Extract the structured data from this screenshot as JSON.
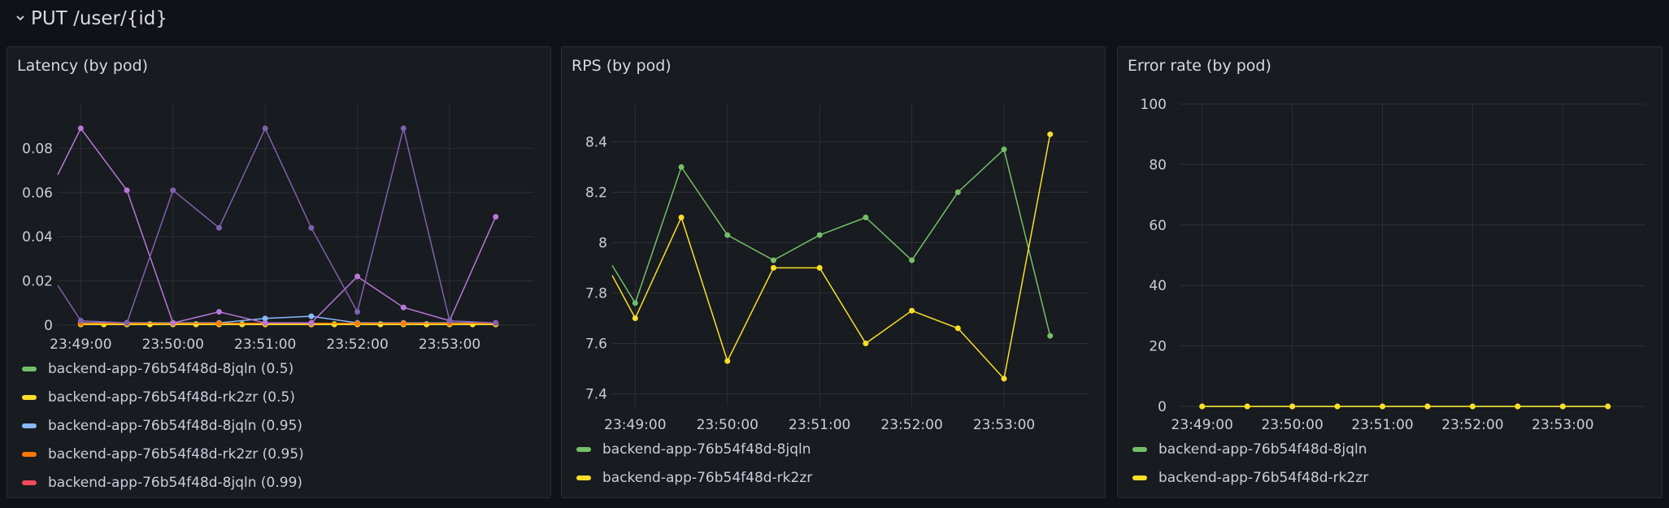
{
  "row": {
    "title": "PUT /user/{id}",
    "chevron": "chevron-down-icon"
  },
  "panels": [
    {
      "title": "Latency (by pod)",
      "legend": [
        {
          "label": "backend-app-76b54f48d-8jqln (0.5)",
          "color": "#73bf69"
        },
        {
          "label": "backend-app-76b54f48d-rk2zr (0.5)",
          "color": "#fade2a"
        },
        {
          "label": "backend-app-76b54f48d-8jqln (0.95)",
          "color": "#8ab8ff"
        },
        {
          "label": "backend-app-76b54f48d-rk2zr (0.95)",
          "color": "#ff780a"
        },
        {
          "label": "backend-app-76b54f48d-8jqln (0.99)",
          "color": "#f2495c"
        }
      ]
    },
    {
      "title": "RPS (by pod)",
      "legend": [
        {
          "label": "backend-app-76b54f48d-8jqln",
          "color": "#73bf69"
        },
        {
          "label": "backend-app-76b54f48d-rk2zr",
          "color": "#fade2a"
        }
      ]
    },
    {
      "title": "Error rate (by pod)",
      "legend": [
        {
          "label": "backend-app-76b54f48d-8jqln",
          "color": "#73bf69"
        },
        {
          "label": "backend-app-76b54f48d-rk2zr",
          "color": "#fade2a"
        }
      ]
    }
  ],
  "chart_data": [
    {
      "type": "line",
      "title": "Latency (by pod)",
      "x": [
        "23:48:45",
        "23:49:00",
        "23:49:15",
        "23:49:30",
        "23:49:45",
        "23:50:00",
        "23:50:15",
        "23:50:30",
        "23:50:45",
        "23:51:00",
        "23:51:15",
        "23:51:30",
        "23:51:45",
        "23:52:00",
        "23:52:15",
        "23:52:30",
        "23:52:45",
        "23:53:00",
        "23:53:15",
        "23:53:30"
      ],
      "x_tick_labels": [
        "23:49:00",
        "23:50:00",
        "23:51:00",
        "23:52:00",
        "23:53:00"
      ],
      "ylim": [
        0,
        0.1
      ],
      "y_ticks": [
        0,
        0.02,
        0.04,
        0.06,
        0.08
      ],
      "y_tick_labels": [
        "0",
        "0.02",
        "0.04",
        "0.06",
        "0.08"
      ],
      "series": [
        {
          "name": "backend-app-76b54f48d-8jqln (0.5)",
          "color": "#73bf69",
          "values": [
            null,
            0.0005,
            0.0005,
            0.0005,
            0.0005,
            0.0005,
            0.0005,
            0.0005,
            0.0005,
            0.0005,
            null,
            0.0005,
            0.0005,
            0.0005,
            0.0005,
            0.0005,
            0.0005,
            0.0005,
            0.0005,
            0.0005
          ]
        },
        {
          "name": "backend-app-76b54f48d-rk2zr (0.5)",
          "color": "#fade2a",
          "values": [
            null,
            0.0003,
            0.0003,
            0.0003,
            0.0003,
            0.0003,
            0.0003,
            0.0003,
            0.0003,
            0.0003,
            null,
            0.0003,
            0.0003,
            0.0003,
            0.0003,
            0.0003,
            0.0003,
            0.0003,
            0.0003,
            0.0003
          ]
        },
        {
          "name": "backend-app-76b54f48d-8jqln (0.95)",
          "color": "#8ab8ff",
          "values": [
            null,
            0.001,
            null,
            0.001,
            null,
            0.001,
            null,
            0.001,
            null,
            0.003,
            null,
            0.004,
            null,
            0.001,
            null,
            0.001,
            null,
            0.001,
            null,
            0.001
          ]
        },
        {
          "name": "backend-app-76b54f48d-rk2zr (0.95)",
          "color": "#ff780a",
          "values": [
            null,
            0.0008,
            null,
            0.0008,
            null,
            0.0008,
            null,
            0.0008,
            null,
            0.0008,
            null,
            0.0008,
            null,
            0.0008,
            null,
            0.0008,
            null,
            0.0008,
            null,
            0.0008
          ]
        },
        {
          "name": "backend-app-76b54f48d-8jqln (0.99)",
          "color": "#f2495c",
          "values": [
            null,
            null,
            null,
            null,
            null,
            null,
            null,
            null,
            null,
            null,
            null,
            null,
            null,
            null,
            null,
            null,
            null,
            null,
            null,
            null
          ]
        },
        {
          "name": "",
          "color": "#b877d9",
          "values": [
            0.068,
            0.089,
            null,
            0.061,
            null,
            0.001,
            null,
            0.006,
            null,
            0.001,
            null,
            0.001,
            null,
            0.022,
            null,
            0.008,
            null,
            0.002,
            null,
            0.049
          ]
        },
        {
          "name": "",
          "color": "#8060b0",
          "values": [
            0.018,
            0.002,
            null,
            0.001,
            null,
            0.061,
            null,
            0.044,
            null,
            0.089,
            null,
            0.044,
            null,
            0.006,
            null,
            0.089,
            null,
            0.002,
            null,
            0.001
          ]
        }
      ]
    },
    {
      "type": "line",
      "title": "RPS (by pod)",
      "x": [
        "23:48:45",
        "23:49:00",
        "23:49:30",
        "23:50:00",
        "23:50:30",
        "23:51:00",
        "23:51:30",
        "23:52:00",
        "23:52:30",
        "23:53:00",
        "23:53:30"
      ],
      "x_tick_labels": [
        "23:49:00",
        "23:50:00",
        "23:51:00",
        "23:52:00",
        "23:53:00"
      ],
      "ylim": [
        7.35,
        8.55
      ],
      "y_ticks": [
        7.4,
        7.6,
        7.8,
        8,
        8.2,
        8.4
      ],
      "y_tick_labels": [
        "7.4",
        "7.6",
        "7.8",
        "8",
        "8.2",
        "8.4"
      ],
      "series": [
        {
          "name": "backend-app-76b54f48d-8jqln",
          "color": "#73bf69",
          "values": [
            7.91,
            7.76,
            8.3,
            8.03,
            7.93,
            8.03,
            8.1,
            7.93,
            8.2,
            8.37,
            7.63
          ]
        },
        {
          "name": "backend-app-76b54f48d-rk2zr",
          "color": "#fade2a",
          "values": [
            7.87,
            7.7,
            8.1,
            7.53,
            7.9,
            7.9,
            7.6,
            7.73,
            7.66,
            7.46,
            8.43
          ]
        }
      ]
    },
    {
      "type": "line",
      "title": "Error rate (by pod)",
      "x": [
        "23:49:00",
        "23:49:30",
        "23:50:00",
        "23:50:30",
        "23:51:00",
        "23:51:30",
        "23:52:00",
        "23:52:30",
        "23:53:00",
        "23:53:30"
      ],
      "x_tick_labels": [
        "23:49:00",
        "23:50:00",
        "23:51:00",
        "23:52:00",
        "23:53:00"
      ],
      "ylim": [
        0,
        100
      ],
      "y_ticks": [
        0,
        20,
        40,
        60,
        80,
        100
      ],
      "y_tick_labels": [
        "0",
        "20",
        "40",
        "60",
        "80",
        "100"
      ],
      "series": [
        {
          "name": "backend-app-76b54f48d-8jqln",
          "color": "#73bf69",
          "values": [
            0,
            0,
            0,
            0,
            0,
            0,
            0,
            0,
            0,
            0
          ]
        },
        {
          "name": "backend-app-76b54f48d-rk2zr",
          "color": "#fade2a",
          "values": [
            0,
            0,
            0,
            0,
            0,
            0,
            0,
            0,
            0,
            0
          ]
        }
      ]
    }
  ]
}
